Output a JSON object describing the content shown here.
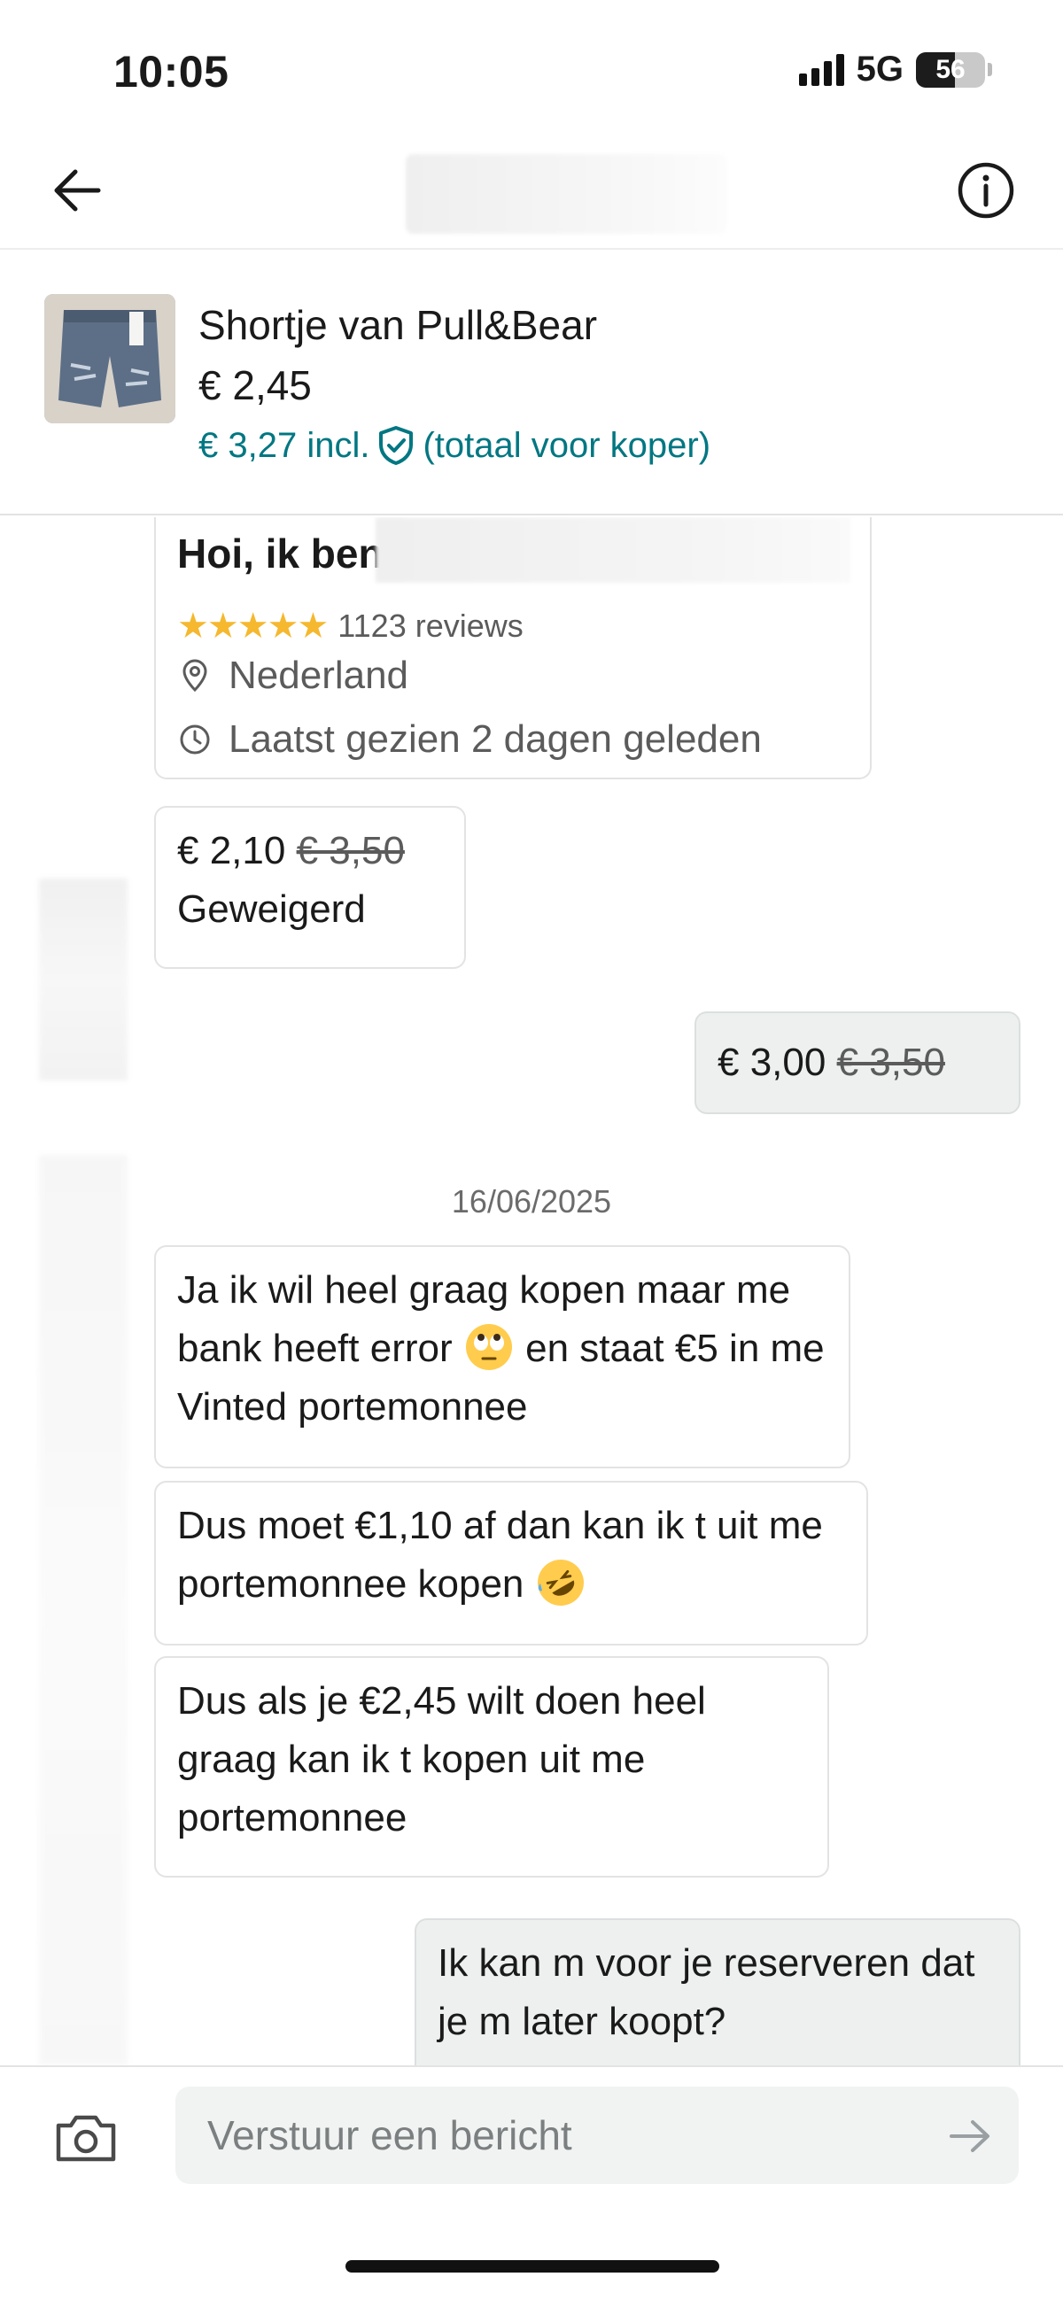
{
  "status_bar": {
    "time": "10:05",
    "network": "5G",
    "battery": "56",
    "battery_level": 0.56
  },
  "header": {
    "back_icon": "arrow-left-icon",
    "info_icon": "info-icon"
  },
  "item": {
    "title": "Shortje van Pull&Bear",
    "price": "€ 2,45",
    "total_price": "€ 3,27 incl.",
    "total_suffix": "(totaal voor koper)",
    "brand_color": "#007782"
  },
  "profile": {
    "greeting": "Hoi, ik ben",
    "rating_stars": "★★★★★",
    "rating_value": 5,
    "reviews": "1123 reviews",
    "location": "Nederland",
    "last_seen": "Laatst gezien 2 dagen geleden"
  },
  "offers": {
    "rejected": {
      "price": "€ 2,10",
      "original": "€ 3,50",
      "status": "Geweigerd"
    },
    "mine": {
      "price": "€ 3,00",
      "original": "€ 3,50"
    }
  },
  "date_separator": "16/06/2025",
  "messages": [
    {
      "text_a": "Ja ik wil heel graag kopen maar me bank heeft error",
      "emoji": "face-with-rolling-eyes",
      "text_b": "en staat €5 in me Vinted portemonnee"
    },
    {
      "text_a": "Dus moet €1,10 af dan kan ik t uit me portemonnee kopen",
      "emoji": "rolling-on-the-floor-laughing"
    },
    {
      "text": "Dus als je €2,45 wilt doen heel graag kan ik t kopen uit me portemonnee"
    },
    {
      "text": "Ik kan m voor je reserveren dat je m later koopt?"
    }
  ],
  "composer": {
    "placeholder": "Verstuur een bericht",
    "camera_icon": "camera-icon",
    "send_icon": "send-arrow-icon"
  },
  "colors": {
    "star": "#f5b82e",
    "teal": "#007782",
    "my_bubble": "#eef0f0"
  }
}
